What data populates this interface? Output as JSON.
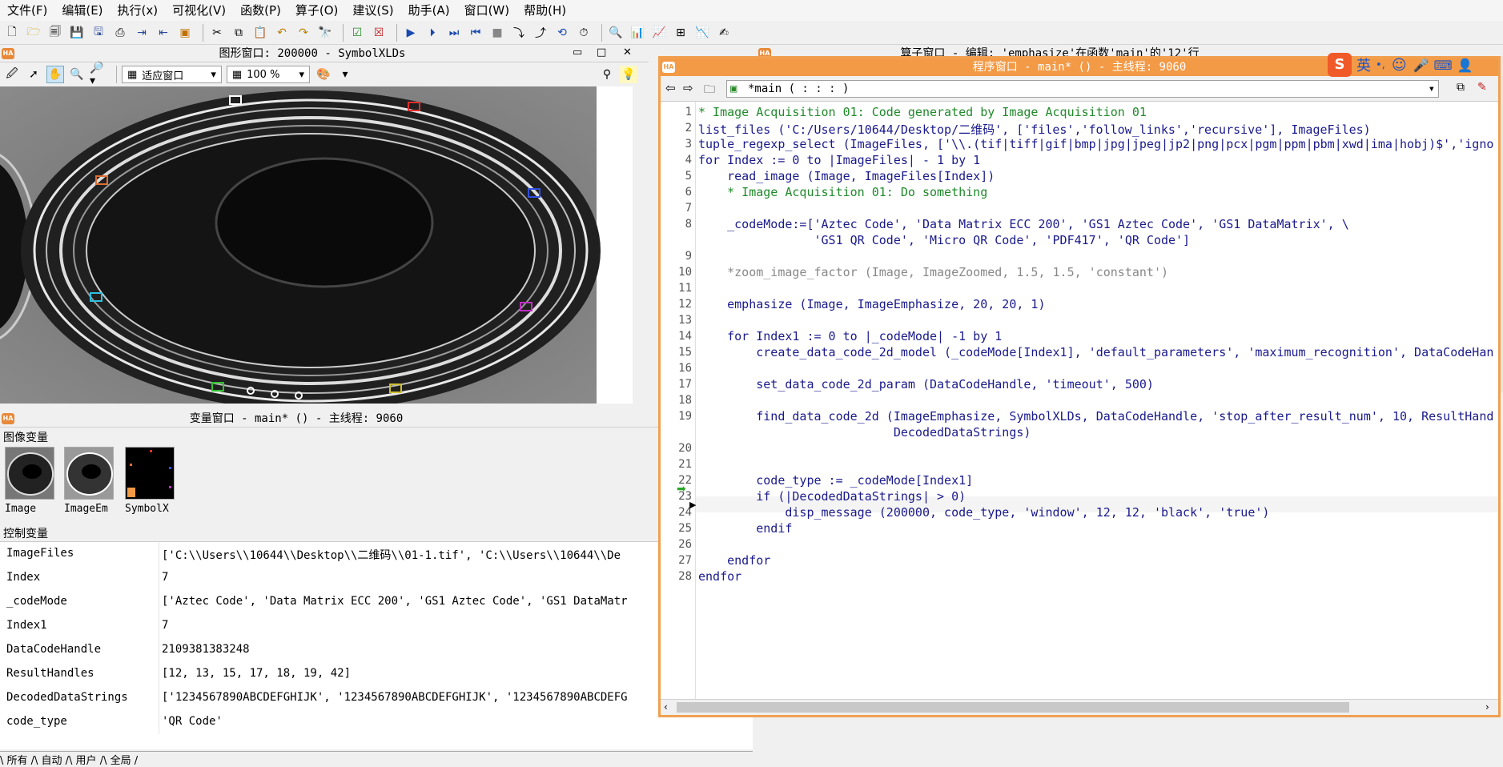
{
  "menu": [
    "文件(F)",
    "编辑(E)",
    "执行(x)",
    "可视化(V)",
    "函数(P)",
    "算子(O)",
    "建议(S)",
    "助手(A)",
    "窗口(W)",
    "帮助(H)"
  ],
  "graphics_window": {
    "title": "图形窗口: 200000 - SymbolXLDs",
    "zoom_fit": "适应窗口",
    "zoom_pct": "100 %"
  },
  "variable_window": {
    "title": "变量窗口 - main* () - 主线程: 9060",
    "image_vars_label": "图像变量",
    "image_vars": [
      "Image",
      "ImageEm",
      "SymbolX"
    ],
    "control_vars_label": "控制变量",
    "control_vars": [
      {
        "name": "ImageFiles",
        "value": "['C:\\\\Users\\\\10644\\\\Desktop\\\\二维码\\\\01-1.tif', 'C:\\\\Users\\\\10644\\\\De"
      },
      {
        "name": "Index",
        "value": "7"
      },
      {
        "name": "_codeMode",
        "value": "['Aztec Code', 'Data Matrix ECC 200', 'GS1 Aztec Code', 'GS1 DataMatr"
      },
      {
        "name": "Index1",
        "value": "7"
      },
      {
        "name": "DataCodeHandle",
        "value": "2109381383248"
      },
      {
        "name": "ResultHandles",
        "value": "[12, 13, 15, 17, 18, 19, 42]"
      },
      {
        "name": "DecodedDataStrings",
        "value": "['1234567890ABCDEFGHIJK', '1234567890ABCDEFGHIJK', '1234567890ABCDEFG"
      },
      {
        "name": "code_type",
        "value": "'QR Code'"
      }
    ],
    "tabs": "\\ 所有 /\\ 自动 /\\ 用户 /\\ 全局 /"
  },
  "operator_window": {
    "title": "算子窗口 - 编辑: 'emphasize'在函数'main'的'12'行"
  },
  "program_window": {
    "title": "程序窗口 - main* () - 主线程: 9060",
    "procedure": "*main ( : : : )",
    "lines": [
      {
        "n": "1",
        "text": "* Image Acquisition 01: Code generated by Image Acquisition 01",
        "kind": "comment"
      },
      {
        "n": "2",
        "text": "list_files ('C:/Users/10644/Desktop/二维码', ['files','follow_links','recursive'], ImageFiles)",
        "kind": "code"
      },
      {
        "n": "3",
        "text": "tuple_regexp_select (ImageFiles, ['\\\\.(tif|tiff|gif|bmp|jpg|jpeg|jp2|png|pcx|pgm|ppm|pbm|xwd|ima|hobj)$','igno",
        "kind": "code"
      },
      {
        "n": "4",
        "text": "for Index := 0 to |ImageFiles| - 1 by 1",
        "kind": "code"
      },
      {
        "n": "5",
        "text": "    read_image (Image, ImageFiles[Index])",
        "kind": "code"
      },
      {
        "n": "6",
        "text": "    * Image Acquisition 01: Do something",
        "kind": "comment"
      },
      {
        "n": "7",
        "text": "",
        "kind": "code"
      },
      {
        "n": "8",
        "text": "    _codeMode:=['Aztec Code', 'Data Matrix ECC 200', 'GS1 Aztec Code', 'GS1 DataMatrix', \\",
        "kind": "code"
      },
      {
        "n": "",
        "text": "                'GS1 QR Code', 'Micro QR Code', 'PDF417', 'QR Code']",
        "kind": "code"
      },
      {
        "n": "9",
        "text": "",
        "kind": "code"
      },
      {
        "n": "10",
        "text": "    *zoom_image_factor (Image, ImageZoomed, 1.5, 1.5, 'constant')",
        "kind": "dim"
      },
      {
        "n": "11",
        "text": "",
        "kind": "code"
      },
      {
        "n": "12",
        "text": "    emphasize (Image, ImageEmphasize, 20, 20, 1)",
        "kind": "code"
      },
      {
        "n": "13",
        "text": "",
        "kind": "code"
      },
      {
        "n": "14",
        "text": "    for Index1 := 0 to |_codeMode| -1 by 1",
        "kind": "code"
      },
      {
        "n": "15",
        "text": "        create_data_code_2d_model (_codeMode[Index1], 'default_parameters', 'maximum_recognition', DataCodeHan",
        "kind": "code"
      },
      {
        "n": "16",
        "text": "",
        "kind": "code"
      },
      {
        "n": "17",
        "text": "        set_data_code_2d_param (DataCodeHandle, 'timeout', 500)",
        "kind": "code"
      },
      {
        "n": "18",
        "text": "",
        "kind": "code"
      },
      {
        "n": "19",
        "text": "        find_data_code_2d (ImageEmphasize, SymbolXLDs, DataCodeHandle, 'stop_after_result_num', 10, ResultHand",
        "kind": "code"
      },
      {
        "n": "",
        "text": "                           DecodedDataStrings)",
        "kind": "code"
      },
      {
        "n": "20",
        "text": "",
        "kind": "code"
      },
      {
        "n": "21",
        "text": "",
        "kind": "code"
      },
      {
        "n": "22",
        "text": "        code_type := _codeMode[Index1]",
        "kind": "code"
      },
      {
        "n": "23",
        "text": "        if (|DecodedDataStrings| > 0)",
        "kind": "code"
      },
      {
        "n": "24",
        "text": "            disp_message (200000, code_type, 'window', 12, 12, 'black', 'true')",
        "kind": "code"
      },
      {
        "n": "25",
        "text": "        endif",
        "kind": "code"
      },
      {
        "n": "26",
        "text": "",
        "kind": "code"
      },
      {
        "n": "27",
        "text": "    endfor",
        "kind": "code"
      },
      {
        "n": "28",
        "text": "endfor",
        "kind": "code"
      }
    ]
  },
  "ime": {
    "lang": "英"
  },
  "colors": {
    "accent": "#f39a47",
    "code": "#1a1a8c",
    "comment": "#1f8a2a"
  }
}
